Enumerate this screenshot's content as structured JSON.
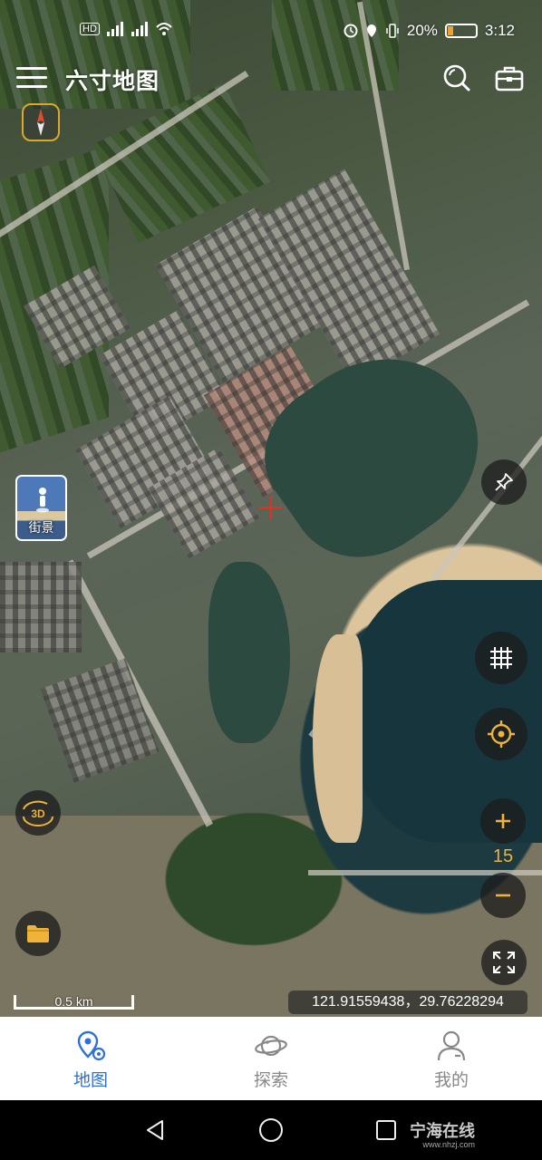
{
  "status_bar": {
    "left_badges": [
      "HD",
      "2",
      "HD",
      "2"
    ],
    "battery_percent": "20%",
    "battery_level": 0.2,
    "time": "3:12"
  },
  "app": {
    "title": "六寸地图",
    "menu_icon": "menu-icon",
    "search_icon": "search-icon",
    "toolbox_icon": "toolbox-icon"
  },
  "map": {
    "compass_icon": "compass-icon",
    "street_view_label": "街景",
    "mode_3d_label": "3D",
    "zoom_in_icon": "plus-icon",
    "zoom_level": "15",
    "zoom_out_icon": "minus-icon",
    "scale_label": "0.5 km",
    "coordinates": "121.91559438，29.76228294",
    "accent_color": "#f0b33a",
    "crosshair_color": "#e3301f"
  },
  "bottom_nav": [
    {
      "label": "地图",
      "icon": "map-pin-icon",
      "active": true
    },
    {
      "label": "探索",
      "icon": "planet-icon",
      "active": false
    },
    {
      "label": "我的",
      "icon": "user-icon",
      "active": false
    }
  ],
  "watermark": {
    "text": "宁海在线",
    "url": "www.nhzj.com"
  },
  "colors": {
    "active_tab": "#2f6fdb",
    "inactive_tab": "#888888"
  }
}
